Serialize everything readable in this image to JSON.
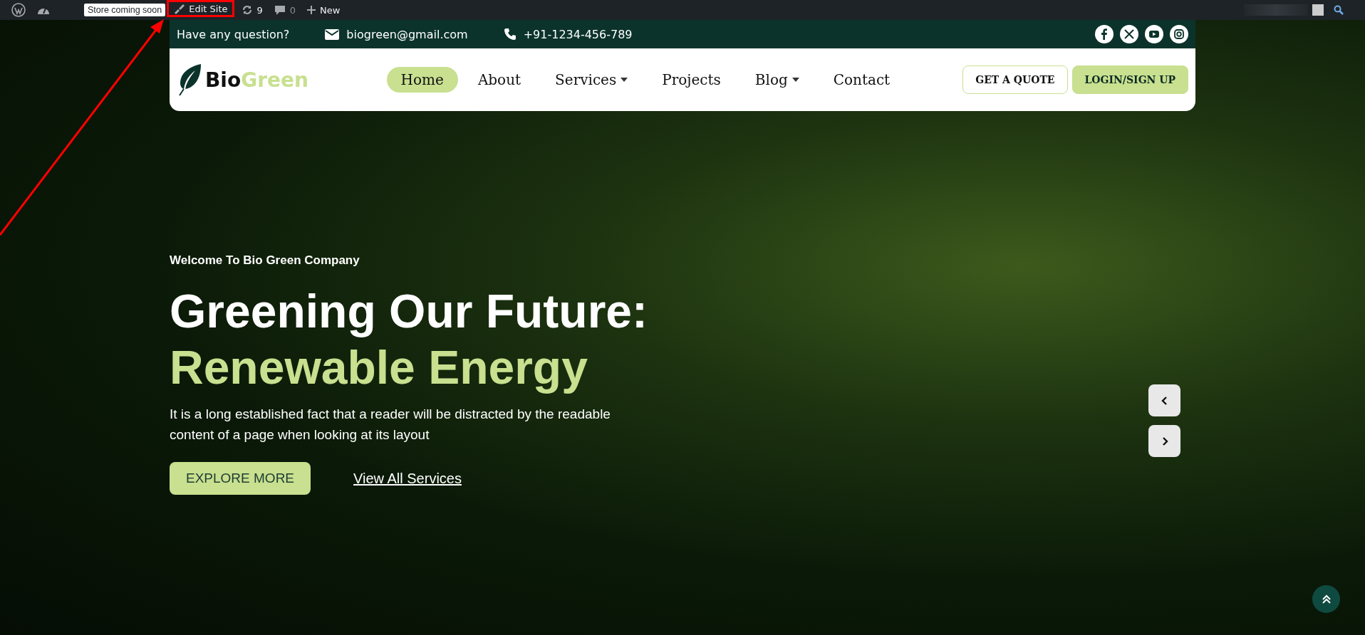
{
  "admin_bar": {
    "badge": "Store coming soon",
    "edit_site": "Edit Site",
    "updates_count": "9",
    "comments_count": "0",
    "new_label": "New"
  },
  "top_bar": {
    "question": "Have any question?",
    "email": "biogreen@gmail.com",
    "phone": "+91-1234-456-789"
  },
  "logo": {
    "first": "Bio",
    "second": "Green"
  },
  "nav": [
    {
      "label": "Home",
      "selected": true,
      "has_dropdown": false
    },
    {
      "label": "About",
      "selected": false,
      "has_dropdown": false
    },
    {
      "label": "Services",
      "selected": false,
      "has_dropdown": true
    },
    {
      "label": "Projects",
      "selected": false,
      "has_dropdown": false
    },
    {
      "label": "Blog",
      "selected": false,
      "has_dropdown": true
    },
    {
      "label": "Contact",
      "selected": false,
      "has_dropdown": false
    }
  ],
  "header_buttons": [
    {
      "label": "GET A QUOTE",
      "kind": "outline"
    },
    {
      "label": "LOGIN/SIGN UP",
      "kind": "filled"
    }
  ],
  "hero": {
    "eyebrow": "Welcome To Bio Green Company",
    "title": "Greening Our Future:",
    "highlight": "Renewable Energy",
    "text": "It is a long established fact that a reader will be distracted by the readable content of a page when looking at its layout",
    "primary_button": "EXPLORE MORE",
    "link": "View All Services"
  }
}
